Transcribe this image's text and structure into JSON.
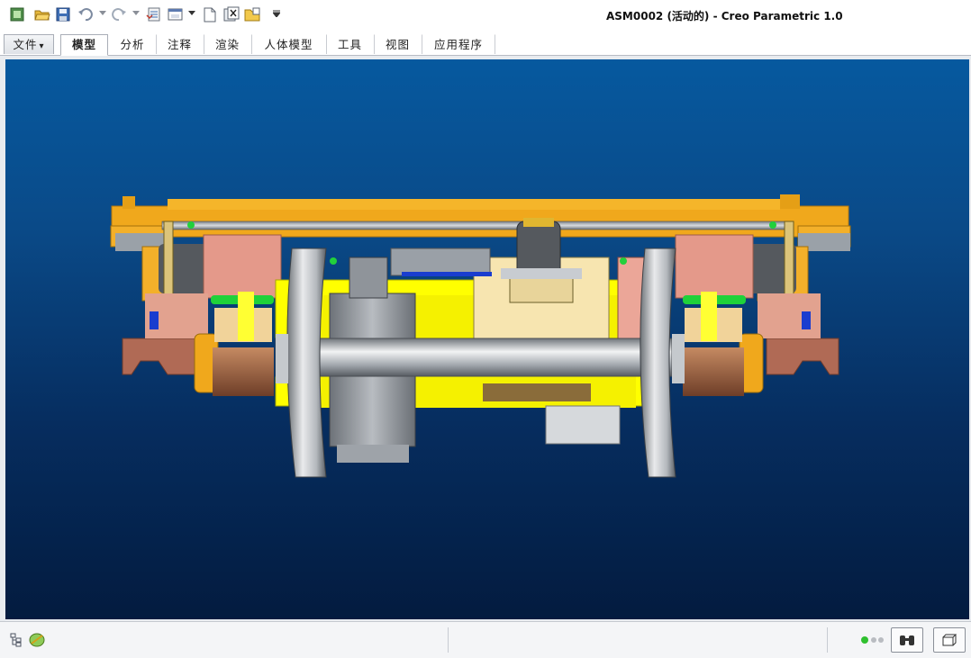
{
  "window": {
    "title": "ASM0002 (活动的) - Creo Parametric 1.0"
  },
  "quick_access": {
    "icons": [
      "app-menu-icon",
      "open-icon",
      "save-icon",
      "undo-icon",
      "redo-icon",
      "regenerate-icon",
      "windows-icon",
      "new-icon",
      "close-window-icon",
      "open-folder-icon",
      "customize-icon"
    ]
  },
  "ribbon": {
    "tabs": [
      {
        "label": "文件"
      },
      {
        "label": "模型"
      },
      {
        "label": "分析"
      },
      {
        "label": "注释"
      },
      {
        "label": "渲染"
      },
      {
        "label": "人体模型"
      },
      {
        "label": "工具"
      },
      {
        "label": "视图"
      },
      {
        "label": "应用程序"
      }
    ],
    "file_tab_arrow": "▾",
    "active_tab": "模型"
  },
  "graphics": {
    "background_top": "#06599f",
    "background_bottom": "#031b3f",
    "model": "bogie-assembly"
  },
  "statusbar": {
    "icons": [
      "model-tree-icon",
      "layer-icon",
      "status-light-icon",
      "find-icon",
      "view-manager-icon"
    ]
  },
  "colors": {
    "frame_orange": "#f0a81c",
    "yellow": "#ffff00",
    "salmon": "#e49a86",
    "grey": "#9da2a8",
    "brown": "#9a5e3e"
  }
}
